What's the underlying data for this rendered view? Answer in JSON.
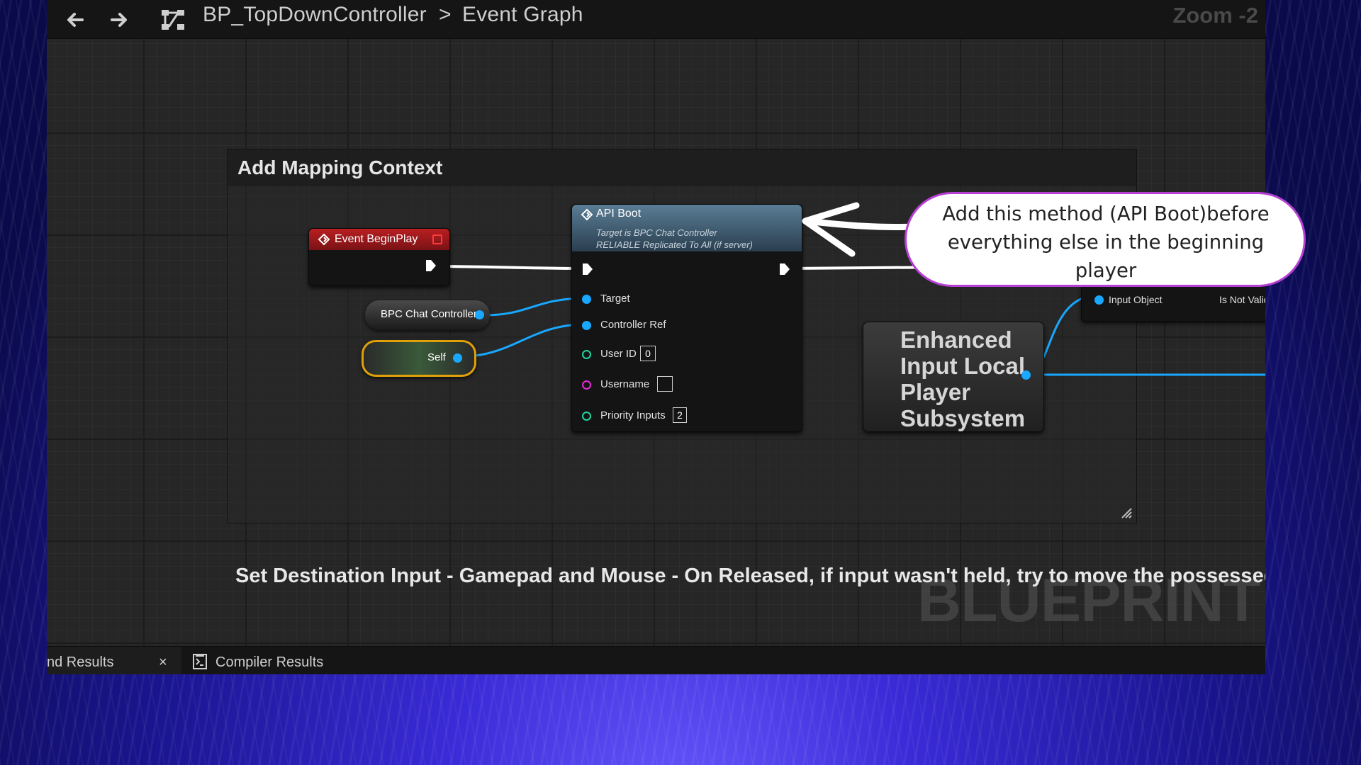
{
  "topbar": {
    "back_icon": "arrow-left-icon",
    "forward_icon": "arrow-right-icon",
    "graph_icon": "blueprint-graph-icon",
    "blueprint_name": "BP_TopDownController",
    "separator": ">",
    "graph_name": "Event Graph",
    "zoom": "Zoom -2"
  },
  "comment_box": {
    "title": "Add Mapping Context"
  },
  "nodes": {
    "event_begin_play": {
      "title": "Event BeginPlay"
    },
    "api_boot": {
      "title": "API Boot",
      "subtitle_1": "Target is BPC Chat Controller",
      "subtitle_2": "RELIABLE Replicated To All (if server)",
      "pins": [
        {
          "label": "Target",
          "value": ""
        },
        {
          "label": "Controller Ref",
          "value": ""
        },
        {
          "label": "User ID",
          "value": "0"
        },
        {
          "label": "Username",
          "value": ""
        },
        {
          "label": "Priority Inputs",
          "value": "2"
        }
      ]
    },
    "bpc_chat_controller": {
      "label": "BPC Chat Controller"
    },
    "self": {
      "label": "Self"
    },
    "enhanced_input": {
      "title": "Enhanced Input Local Player Subsystem"
    },
    "is_valid": {
      "input_label": "Input Object",
      "output_label": "Is Not Valid"
    }
  },
  "second_comment": {
    "title": "Set Destination Input - Gamepad and Mouse - On Released, if input wasn't held, try to move the possessed chara"
  },
  "watermark": "BLUEPRINT",
  "bottom_tabs": [
    {
      "label": "nd Results",
      "close": "×"
    },
    {
      "label": "Compiler Results"
    }
  ],
  "callout": {
    "text": "Add this method (API Boot)before everything else in the beginning player"
  },
  "colors": {
    "exec_wire": "#ffffff",
    "object_pin": "#19a8ff",
    "int_pin": "#1fd6a0",
    "string_pin": "#e42bd8",
    "event_header": "#b81f22",
    "function_header": "#5a7d95",
    "callout_border": "#b640d4"
  }
}
